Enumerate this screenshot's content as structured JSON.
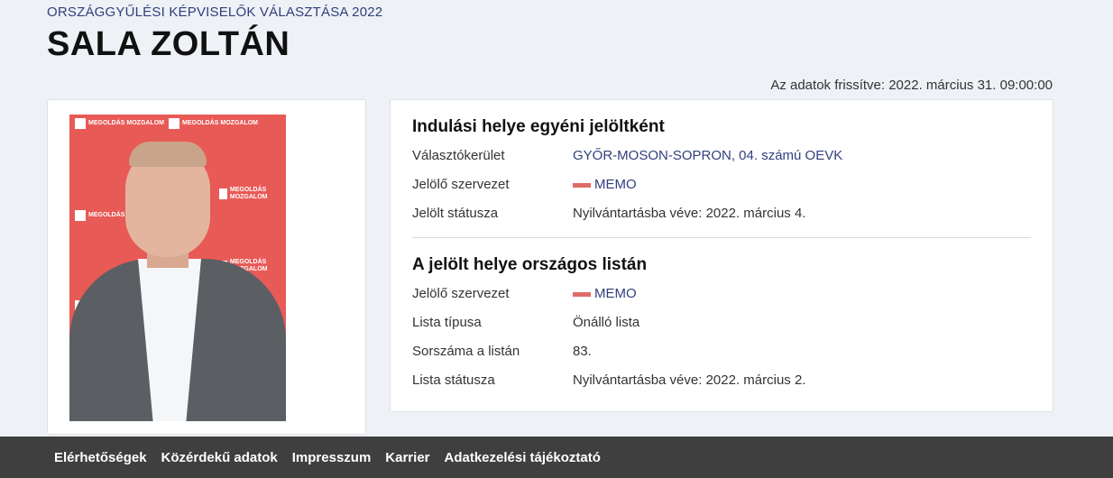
{
  "header": {
    "election_title": "ORSZÁGGYŰLÉSI KÉPVISELŐK VÁLASZTÁSA 2022",
    "candidate_name": "SALA ZOLTÁN",
    "updated": "Az adatok frissítve: 2022. március 31. 09:00:00"
  },
  "photo": {
    "logo_text": "MEGOLDÁS MOZGALOM",
    "background_color": "#e85a56"
  },
  "individual": {
    "title": "Indulási helye egyéni jelöltként",
    "rows": [
      {
        "label": "Választókerület",
        "value": "GYŐR-MOSON-SOPRON, 04. számú OEVK"
      },
      {
        "label": "Jelölő szervezet",
        "value": "MEMO"
      },
      {
        "label": "Jelölt státusza",
        "value": "Nyilvántartásba véve: 2022. március 4."
      }
    ]
  },
  "national_list": {
    "title": "A jelölt helye országos listán",
    "rows": [
      {
        "label": "Jelölő szervezet",
        "value": "MEMO"
      },
      {
        "label": "Lista típusa",
        "value": "Önálló lista"
      },
      {
        "label": "Sorszáma a listán",
        "value": "83."
      },
      {
        "label": "Lista státusza",
        "value": "Nyilvántartásba véve: 2022. március 2."
      }
    ]
  },
  "footer": {
    "links": [
      "Elérhetőségek",
      "Közérdekű adatok",
      "Impresszum",
      "Karrier",
      "Adatkezelési tájékoztató"
    ]
  },
  "colors": {
    "accent": "#2f3f7d",
    "party": "#e06a68",
    "footer_bg": "#3f3f3f"
  }
}
